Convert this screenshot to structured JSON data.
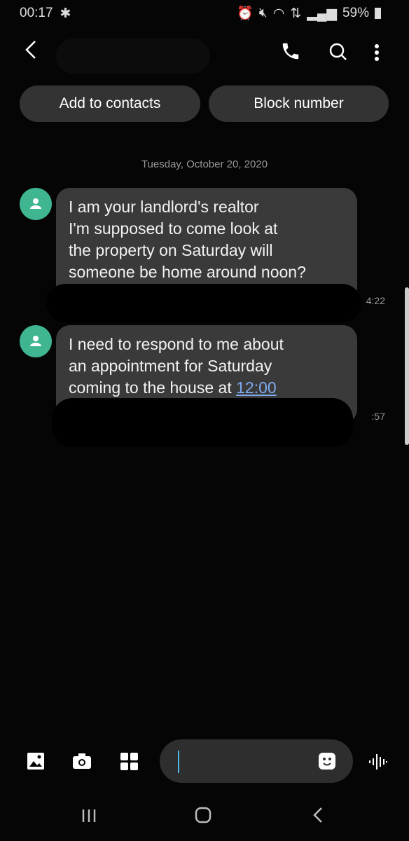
{
  "status_bar": {
    "time": "00:17",
    "battery": "59%",
    "icons": [
      "gear-icon",
      "alarm-icon",
      "mute-icon",
      "wifi-icon",
      "data-icon",
      "signal-icon",
      "battery-icon"
    ]
  },
  "header": {
    "icons": [
      "back-icon",
      "phone-icon",
      "search-icon",
      "more-icon"
    ]
  },
  "actions": {
    "add_contacts": "Add to contacts",
    "block_number": "Block number"
  },
  "date_divider": "Tuesday, October 20, 2020",
  "messages": [
    {
      "lines": [
        "I am your landlord's realtor",
        "I'm supposed to come look at",
        "the property on Saturday will",
        "someone be home around noon?"
      ],
      "time": "4:22"
    },
    {
      "lines": [
        "I need to respond to me about",
        "an appointment for Saturday"
      ],
      "line3_prefix": "coming to the house at ",
      "link": "12:00",
      "time": ":57"
    }
  ],
  "colors": {
    "avatar": "#3fb592",
    "bubble": "#3a3a3a",
    "link": "#7eaaf0",
    "cursor": "#4fb8e6"
  }
}
